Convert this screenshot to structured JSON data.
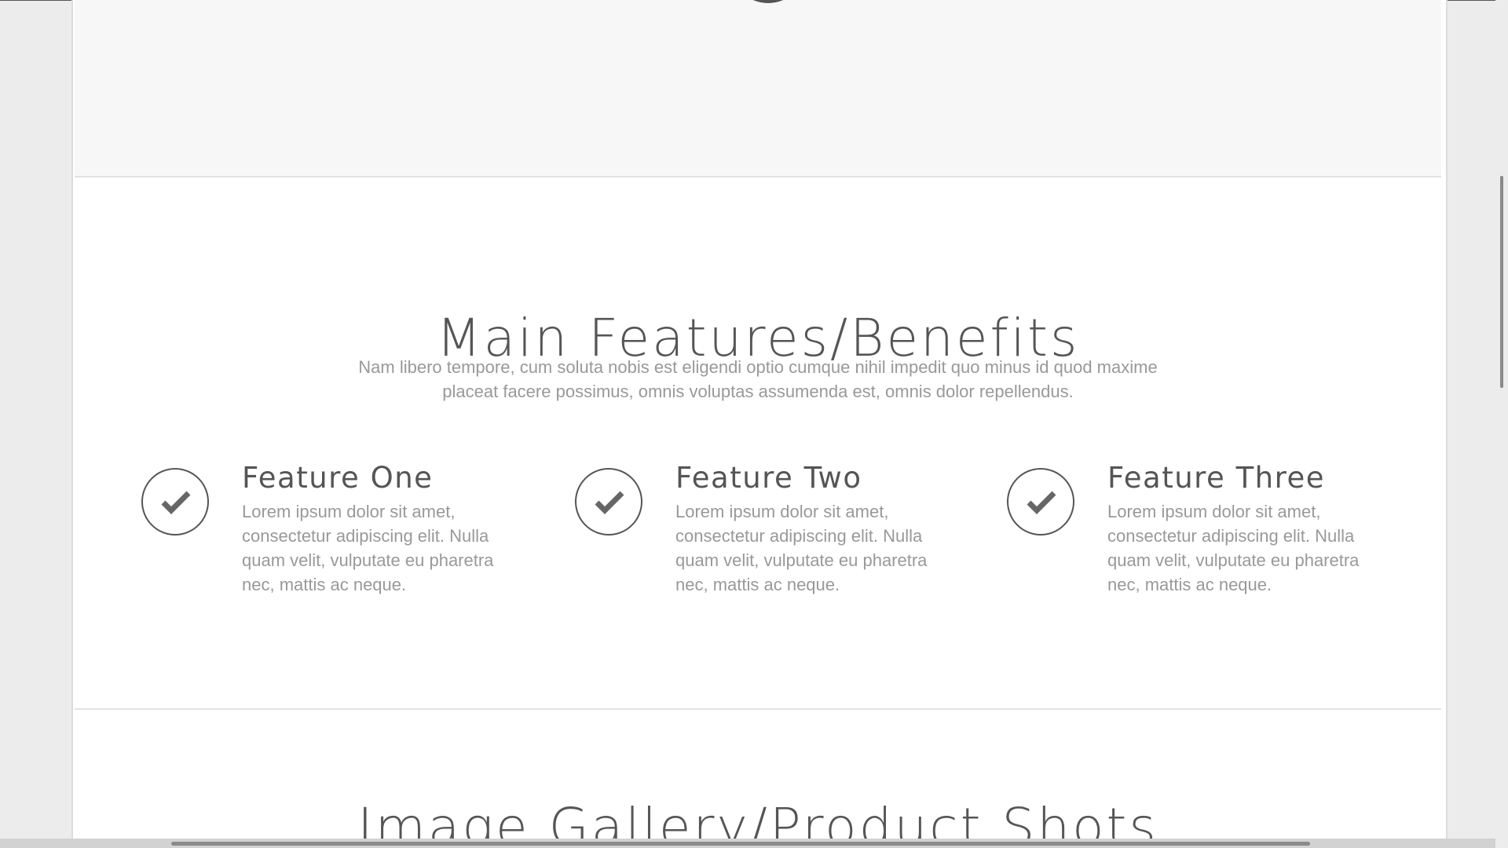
{
  "features_section": {
    "title": "Main Features/Benefits",
    "description": "Nam libero tempore, cum soluta nobis est eligendi optio cumque nihil impedit quo minus id quod maxime placeat facere possimus, omnis voluptas assumenda est, omnis dolor repellendus.",
    "items": [
      {
        "title": "Feature One",
        "text": "Lorem ipsum dolor sit amet, consectetur adipiscing elit. Nulla quam velit, vulputate eu pharetra nec, mattis ac neque.",
        "icon": "check-circle-icon"
      },
      {
        "title": "Feature Two",
        "text": "Lorem ipsum dolor sit amet, consectetur adipiscing elit. Nulla quam velit, vulputate eu pharetra nec, mattis ac neque.",
        "icon": "check-circle-icon"
      },
      {
        "title": "Feature Three",
        "text": "Lorem ipsum dolor sit amet, consectetur adipiscing elit. Nulla quam velit, vulputate eu pharetra nec, mattis ac neque.",
        "icon": "check-circle-icon"
      }
    ]
  },
  "gallery_section": {
    "title": "Image Gallery/Product Shots"
  },
  "colors": {
    "heading": "#555555",
    "body_text": "#999999",
    "page_background": "#ffffff",
    "outer_background": "#ececec",
    "prev_section_background": "#f7f7f7"
  }
}
